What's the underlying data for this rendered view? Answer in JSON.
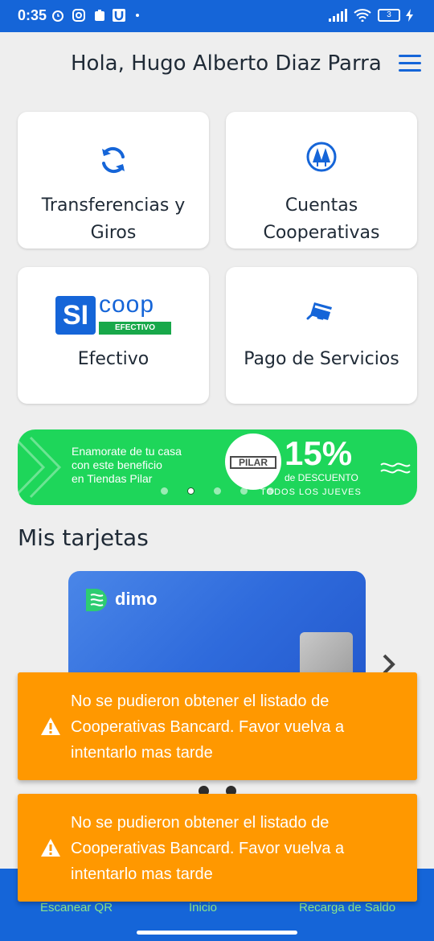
{
  "status_bar": {
    "time": "0:35",
    "battery": "3"
  },
  "header": {
    "greeting": "Hola, Hugo Alberto Diaz Parra",
    "menu_icon": "hamburger-menu-icon"
  },
  "quick_actions": [
    {
      "label": "Transferencias y Giros",
      "icon": "refresh-transfer-icon"
    },
    {
      "label": "Cuentas Cooperativas",
      "icon": "cooperative-pine-trees-icon"
    },
    {
      "label": "Efectivo",
      "icon": "siccoop-logo"
    },
    {
      "label": "Pago de Servicios",
      "icon": "credit-card-payment-icon"
    }
  ],
  "siccoop_logo": {
    "si": "SI",
    "coop": "coop",
    "efectivo": "EFECTIVO"
  },
  "banner": {
    "line1": "Enamorate de tu casa",
    "line2": "con este beneficio",
    "line3": "en Tiendas Pilar",
    "brand": "PILAR",
    "discount": "15%",
    "discount_label": "de DESCUENTO",
    "days": "TODOS LOS JUEVES",
    "slide_count": 5,
    "active_slide": 2,
    "color": "#1ed65a"
  },
  "cards_section": {
    "title": "Mis tarjetas",
    "card_brand": "dimo"
  },
  "toasts": [
    {
      "message": "No se pudieron obtener el listado de Cooperativas Bancard. Favor vuelva a intentarlo mas tarde"
    },
    {
      "message": "No se pudieron obtener el listado de Cooperativas Bancard. Favor vuelva a intentarlo mas tarde"
    }
  ],
  "bottom_nav": {
    "items": [
      {
        "label": "Escanear QR"
      },
      {
        "label": "Inicio"
      },
      {
        "label": "Recarga de Saldo"
      }
    ]
  },
  "colors": {
    "primary": "#1565d8",
    "toast": "#ff9800",
    "banner": "#1ed65a"
  }
}
